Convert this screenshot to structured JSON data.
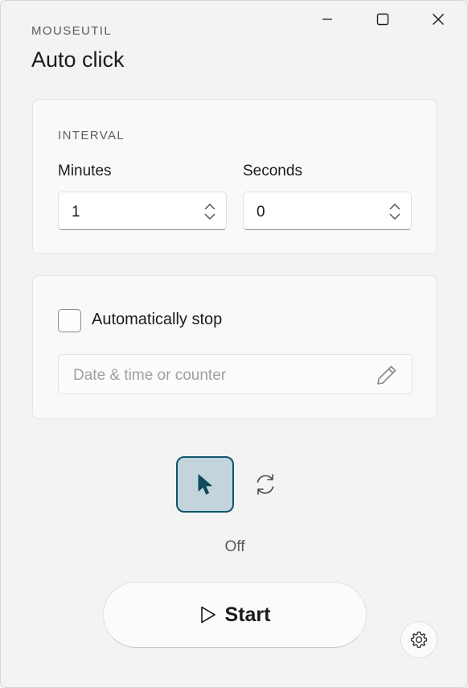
{
  "window": {
    "caption": "MOUSEUTIL",
    "title": "Auto click"
  },
  "interval": {
    "heading": "INTERVAL",
    "minutes_label": "Minutes",
    "minutes_value": "1",
    "seconds_label": "Seconds",
    "seconds_value": "0"
  },
  "auto_stop": {
    "checkbox_label": "Automatically stop",
    "checked": false,
    "input_placeholder": "Date & time or counter"
  },
  "modes": {
    "selected": "cursor",
    "items": [
      "cursor-icon",
      "repeat-icon"
    ]
  },
  "status": {
    "text": "Off"
  },
  "actions": {
    "start_label": "Start"
  },
  "colors": {
    "accent": "#0f5569",
    "accent_fill": "#c3d4dc",
    "background": "#f3f3f3",
    "card": "#f9f9f9"
  }
}
